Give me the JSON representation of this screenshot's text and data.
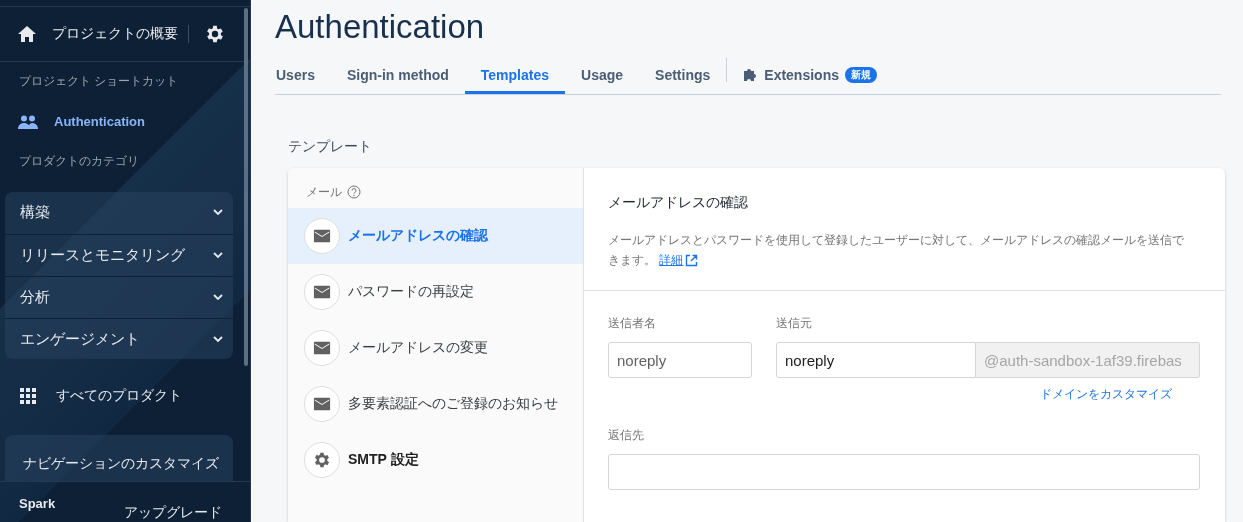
{
  "sidebar": {
    "project_overview": "プロジェクトの概要",
    "shortcuts_heading": "プロジェクト ショートカット",
    "shortcuts": [
      {
        "label": "Authentication",
        "selected": true
      }
    ],
    "categories_heading": "プロダクトのカテゴリ",
    "categories": [
      {
        "label": "構築",
        "expanded": false
      },
      {
        "label": "リリースとモニタリング",
        "expanded": false
      },
      {
        "label": "分析",
        "expanded": false
      },
      {
        "label": "エンゲージメント",
        "expanded": false
      }
    ],
    "all_products": "すべてのプロダクト",
    "customize": "ナビゲーションのカスタマイズ",
    "plan": "Spark",
    "upgrade": "アップグレード"
  },
  "page": {
    "title": "Authentication",
    "tabs": [
      {
        "label": "Users",
        "selected": false,
        "kind": "plain"
      },
      {
        "label": "Sign-in method",
        "selected": false,
        "kind": "plain"
      },
      {
        "label": "Templates",
        "selected": true,
        "kind": "plain"
      },
      {
        "label": "Usage",
        "selected": false,
        "kind": "plain"
      },
      {
        "label": "Settings",
        "selected": false,
        "kind": "plain"
      },
      {
        "label": "Extensions",
        "selected": false,
        "kind": "extension",
        "badge": "新規"
      }
    ]
  },
  "templates": {
    "heading": "テンプレート",
    "email_section": "メール",
    "items": [
      {
        "label": "メールアドレスの確認",
        "kind": "mail",
        "selected": true
      },
      {
        "label": "パスワードの再設定",
        "kind": "mail",
        "selected": false
      },
      {
        "label": "メールアドレスの変更",
        "kind": "mail",
        "selected": false
      },
      {
        "label": "多要素認証へのご登録のお知らせ",
        "kind": "mail",
        "selected": false
      },
      {
        "label": "SMTP 設定",
        "kind": "settings",
        "selected": false
      }
    ],
    "detail": {
      "title": "メールアドレスの確認",
      "description": "メールアドレスとパスワードを使用して登録したユーザーに対して、メールアドレスの確認メールを送信できます。",
      "link": "詳細",
      "sender_name": {
        "label": "送信者名",
        "value": "noreply"
      },
      "from": {
        "label": "送信元",
        "value": "noreply",
        "domain": "@auth-sandbox-1af39.firebas"
      },
      "customize_domain": "ドメインをカスタマイズ",
      "reply_to": {
        "label": "返信先"
      }
    }
  }
}
